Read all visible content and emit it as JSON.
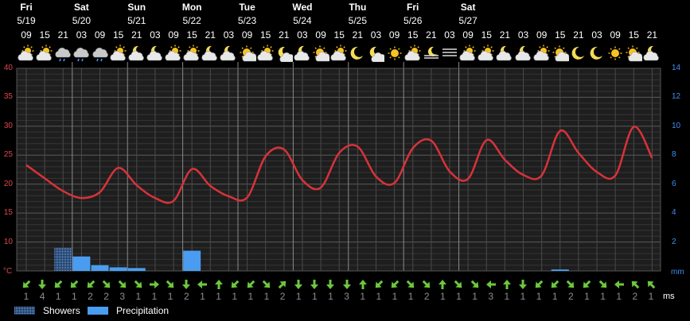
{
  "days": [
    {
      "name": "Fri",
      "date": "5/19"
    },
    {
      "name": "Sat",
      "date": "5/20"
    },
    {
      "name": "Sun",
      "date": "5/21"
    },
    {
      "name": "Mon",
      "date": "5/22"
    },
    {
      "name": "Tue",
      "date": "5/23"
    },
    {
      "name": "Wed",
      "date": "5/24"
    },
    {
      "name": "Thu",
      "date": "5/25"
    },
    {
      "name": "Fri",
      "date": "5/26"
    },
    {
      "name": "Sat",
      "date": "5/27"
    }
  ],
  "hours": [
    "09",
    "15",
    "21",
    "03",
    "09",
    "15",
    "21",
    "03",
    "09",
    "15",
    "21",
    "03",
    "09",
    "15",
    "21",
    "03",
    "09",
    "15",
    "21",
    "03",
    "09",
    "15",
    "21",
    "03",
    "09",
    "15",
    "21",
    "03",
    "09",
    "15",
    "21",
    "03",
    "09",
    "15",
    "21"
  ],
  "weather_icons": [
    "partly-cloudy-sun-icon",
    "partly-cloudy-sun-icon",
    "rain-cloud-icon",
    "rain-cloud-icon",
    "rain-cloud-icon",
    "partly-cloudy-sun-icon",
    "partly-cloudy-moon-icon",
    "partly-cloudy-moon-icon",
    "partly-cloudy-sun-icon",
    "partly-cloudy-sun-icon",
    "partly-cloudy-moon-icon",
    "partly-cloudy-moon-icon",
    "sun-cloud-icon",
    "partly-cloudy-sun-icon",
    "moon-cloud-icon",
    "partly-cloudy-moon-icon",
    "sun-cloud-icon",
    "partly-cloudy-sun-icon",
    "moon-icon",
    "moon-cloud-icon",
    "sun-icon",
    "partly-cloudy-sun-icon",
    "fog-moon-icon",
    "fog-icon",
    "partly-cloudy-sun-icon",
    "partly-cloudy-sun-icon",
    "partly-cloudy-moon-icon",
    "partly-cloudy-moon-icon",
    "partly-cloudy-sun-icon",
    "sun-cloud-icon",
    "moon-icon",
    "moon-icon",
    "sun-icon",
    "sun-cloud-icon",
    "partly-cloudy-moon-icon"
  ],
  "axis": {
    "temp_unit": "°C",
    "precip_unit": "mm",
    "wind_unit": "ms"
  },
  "legend": {
    "showers": "Showers",
    "precipitation": "Precipitation"
  },
  "colors": {
    "temperature": "#d8323a",
    "showers": "#5a8cc8",
    "precipitation": "#4a9cf0",
    "wind_arrow": "#6cc83c",
    "grid": "#4a4a4a",
    "day_line": "#8a8a8a",
    "temp_axis": "#e0484a",
    "precip_axis": "#3f8ef0",
    "speed_text": "#8d8d8d"
  },
  "wind": {
    "speeds": [
      "1",
      "4",
      "1",
      "1",
      "2",
      "2",
      "3",
      "1",
      "1",
      "1",
      "2",
      "1",
      "1",
      "1",
      "1",
      "1",
      "2",
      "1",
      "1",
      "1",
      "3",
      "1",
      "1",
      "1",
      "1",
      "2",
      "1",
      "1",
      "1",
      "3",
      "1",
      "1",
      "1",
      "1",
      "2",
      "1",
      "1",
      "1",
      "2",
      "1"
    ],
    "direction_icons": [
      "arrow-southwest-icon",
      "arrow-south-icon",
      "arrow-southwest-icon",
      "arrow-southwest-icon",
      "arrow-southwest-icon",
      "arrow-southeast-icon",
      "arrow-southeast-icon",
      "arrow-southeast-icon",
      "arrow-east-icon",
      "arrow-southeast-icon",
      "arrow-south-icon",
      "arrow-west-icon",
      "arrow-north-icon",
      "arrow-southwest-icon",
      "arrow-southwest-icon",
      "arrow-southeast-icon",
      "arrow-northeast-icon",
      "arrow-south-icon",
      "arrow-south-icon",
      "arrow-south-icon",
      "arrow-south-icon",
      "arrow-north-icon",
      "arrow-southwest-icon",
      "arrow-southwest-icon",
      "arrow-southeast-icon",
      "arrow-southeast-icon",
      "arrow-north-icon",
      "arrow-southeast-icon",
      "arrow-southeast-icon",
      "arrow-west-icon",
      "arrow-north-icon",
      "arrow-south-icon",
      "arrow-southwest-icon",
      "arrow-southwest-icon",
      "arrow-southeast-icon",
      "arrow-southwest-icon",
      "arrow-southeast-icon",
      "arrow-west-icon",
      "arrow-northwest-icon",
      "arrow-northwest-icon"
    ]
  },
  "chart_data": {
    "type": "line",
    "x": [
      "5/19 09",
      "5/19 15",
      "5/19 21",
      "5/20 03",
      "5/20 09",
      "5/20 15",
      "5/20 21",
      "5/21 03",
      "5/21 09",
      "5/21 15",
      "5/21 21",
      "5/22 03",
      "5/22 09",
      "5/22 15",
      "5/22 21",
      "5/23 03",
      "5/23 09",
      "5/23 15",
      "5/23 21",
      "5/24 03",
      "5/24 09",
      "5/24 15",
      "5/24 21",
      "5/25 03",
      "5/25 09",
      "5/25 15",
      "5/25 21",
      "5/26 03",
      "5/26 09",
      "5/26 15",
      "5/26 21",
      "5/27 03",
      "5/27 09",
      "5/27 15",
      "5/27 21"
    ],
    "series": [
      {
        "values": [
          23.3,
          21.0,
          18.8,
          17.6,
          18.6,
          22.8,
          19.8,
          17.6,
          17.1,
          22.6,
          19.7,
          17.9,
          17.7,
          24.8,
          26.0,
          20.7,
          19.4,
          25.4,
          26.5,
          21.3,
          20.2,
          26.2,
          27.5,
          22.2,
          20.9,
          27.6,
          24.2,
          21.6,
          21.5,
          29.2,
          25.4,
          22.1,
          21.5,
          29.9,
          24.5
        ]
      }
    ],
    "bars": {
      "showers": [
        0,
        0,
        1.6,
        0,
        0,
        0,
        0,
        0,
        0,
        0,
        0,
        0,
        0,
        0,
        0,
        0,
        0,
        0,
        0,
        0,
        0,
        0,
        0,
        0,
        0,
        0,
        0,
        0,
        0,
        0,
        0,
        0,
        0,
        0,
        0
      ],
      "precipitation": [
        0,
        0,
        0,
        1.0,
        0.4,
        0.25,
        0.2,
        0,
        0,
        1.4,
        0,
        0,
        0,
        0,
        0,
        0,
        0,
        0,
        0,
        0,
        0,
        0,
        0,
        0,
        0,
        0,
        0,
        0,
        0,
        0.1,
        0,
        0,
        0,
        0,
        0
      ]
    },
    "y_left": {
      "range": [
        5,
        40
      ],
      "ticks": [
        "40",
        "35",
        "30",
        "25",
        "20",
        "15",
        "10"
      ],
      "unit": "°C"
    },
    "y_right": {
      "range": [
        0,
        14
      ],
      "ticks": [
        "14",
        "12",
        "10",
        "8",
        "6",
        "4",
        "2"
      ],
      "unit": "mm"
    },
    "grid": true,
    "legend_position": "bottom-left"
  }
}
